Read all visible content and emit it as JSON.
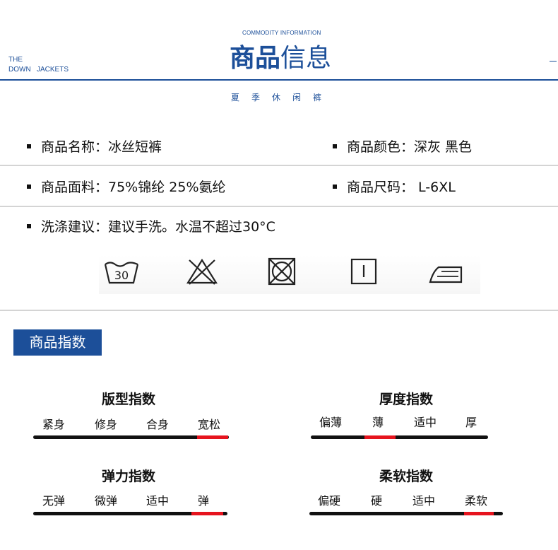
{
  "header": {
    "subtitle_en": "COMMODITY INFORMATION",
    "title_bold": "商品",
    "title_light": "信息",
    "side_line1": "THE",
    "side_line2": "DOWN   JACKETS",
    "category": "夏季休闲裤"
  },
  "info": {
    "name": "商品名称：冰丝短裤",
    "color": "商品颜色：深灰 黑色",
    "fabric": "商品面料：75%锦纶 25%氨纶",
    "size": "商品尺码： L-6XL",
    "wash": "洗涤建议：建议手洗。水温不超过30°C"
  },
  "care_icons": [
    {
      "name": "wash-30-icon",
      "text": "30"
    },
    {
      "name": "no-bleach-icon"
    },
    {
      "name": "no-tumble-dry-icon"
    },
    {
      "name": "drip-dry-icon"
    },
    {
      "name": "iron-icon"
    }
  ],
  "index_section": {
    "badge": "商品指数",
    "indices": [
      {
        "title": "版型指数",
        "labels": [
          "紧身",
          "修身",
          "合身",
          "宽松"
        ],
        "selected": 3
      },
      {
        "title": "厚度指数",
        "labels": [
          "偏薄",
          "薄",
          "适中",
          "厚"
        ],
        "selected": 1
      },
      {
        "title": "弹力指数",
        "labels": [
          "无弹",
          "微弹",
          "适中",
          "弹"
        ],
        "selected": 3
      },
      {
        "title": "柔软指数",
        "labels": [
          "偏硬",
          "硬",
          "适中",
          "柔软"
        ],
        "selected": 3
      }
    ]
  }
}
